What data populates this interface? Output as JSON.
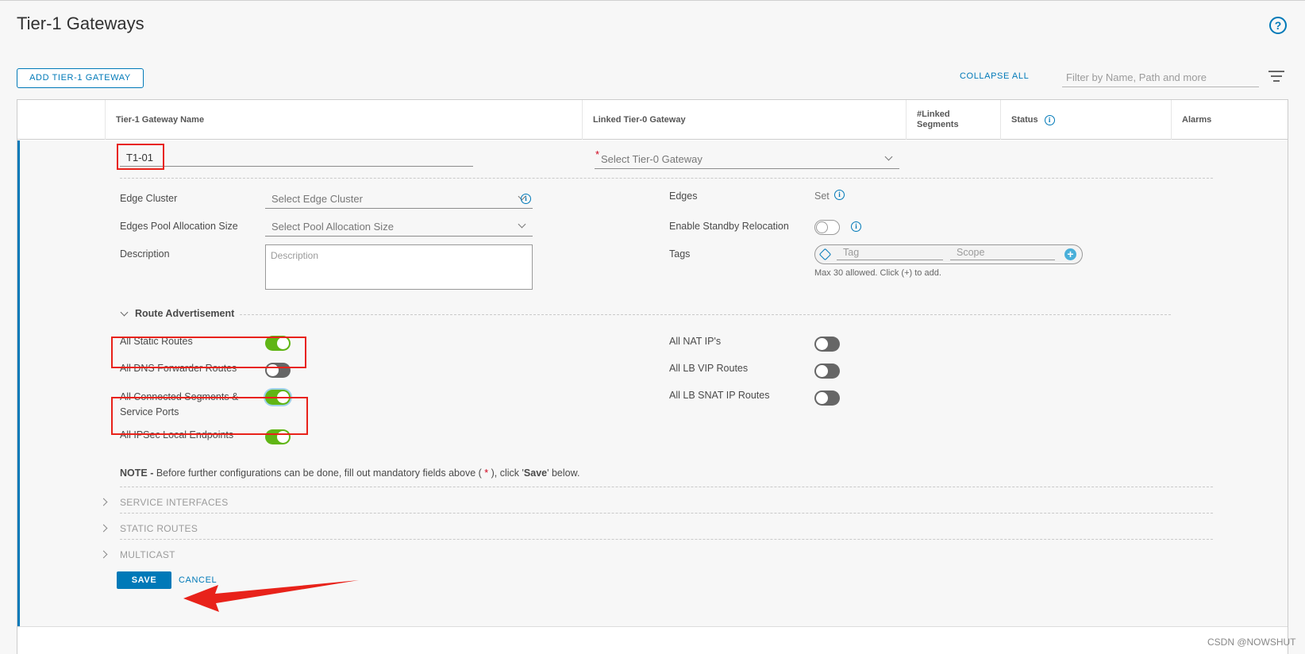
{
  "page": {
    "title": "Tier-1 Gateways",
    "help_icon": "help-circle-icon"
  },
  "toolbar": {
    "add_button": "ADD TIER-1 GATEWAY",
    "collapse_all": "COLLAPSE ALL",
    "filter_placeholder": "Filter by Name, Path and more",
    "filter_icon": "filter-lines-icon"
  },
  "grid": {
    "columns": {
      "name": "Tier-1 Gateway Name",
      "linked_t0": "Linked Tier-0 Gateway",
      "linked_segments": "#Linked\nSegments",
      "status": "Status",
      "alarms": "Alarms"
    }
  },
  "form": {
    "name_value": "T1-01",
    "required_marker": "*",
    "tier0_placeholder": "Select Tier-0 Gateway",
    "edge_cluster": {
      "label": "Edge Cluster",
      "placeholder": "Select Edge Cluster"
    },
    "pool_allocation": {
      "label": "Edges Pool Allocation Size",
      "placeholder": "Select Pool Allocation Size"
    },
    "description": {
      "label": "Description",
      "placeholder": "Description"
    },
    "edges": {
      "label": "Edges",
      "value": "Set"
    },
    "standby_relocation": {
      "label": "Enable Standby Relocation",
      "enabled": false
    },
    "tags": {
      "label": "Tags",
      "tag_placeholder": "Tag",
      "scope_placeholder": "Scope",
      "add_symbol": "+",
      "hint": "Max 30 allowed. Click (+) to add."
    },
    "route_advertisement": {
      "title": "Route Advertisement",
      "left": [
        {
          "label": "All Static Routes",
          "enabled": true
        },
        {
          "label": "All DNS Forwarder Routes",
          "enabled": false
        },
        {
          "label": "All Connected Segments &\nService Ports",
          "enabled": true
        },
        {
          "label": "All IPSec Local Endpoints",
          "enabled": true
        }
      ],
      "right": [
        {
          "label": "All NAT IP's",
          "enabled": false
        },
        {
          "label": "All LB VIP Routes",
          "enabled": false
        },
        {
          "label": "All LB SNAT IP Routes",
          "enabled": false
        }
      ]
    },
    "note": {
      "prefix": "NOTE -",
      "text_a": " Before further configurations can be done, fill out mandatory fields above ( ",
      "star": "*",
      "text_b": " ), click '",
      "save_word": "Save",
      "text_c": "' below."
    },
    "sections": [
      "SERVICE INTERFACES",
      "STATIC ROUTES",
      "MULTICAST"
    ],
    "save_button": "SAVE",
    "cancel_button": "CANCEL"
  },
  "annotation_color": "#e8221a",
  "accent_color": "#0079b8",
  "toggle_on_color": "#60b515",
  "watermark": "CSDN @NOWSHUT"
}
